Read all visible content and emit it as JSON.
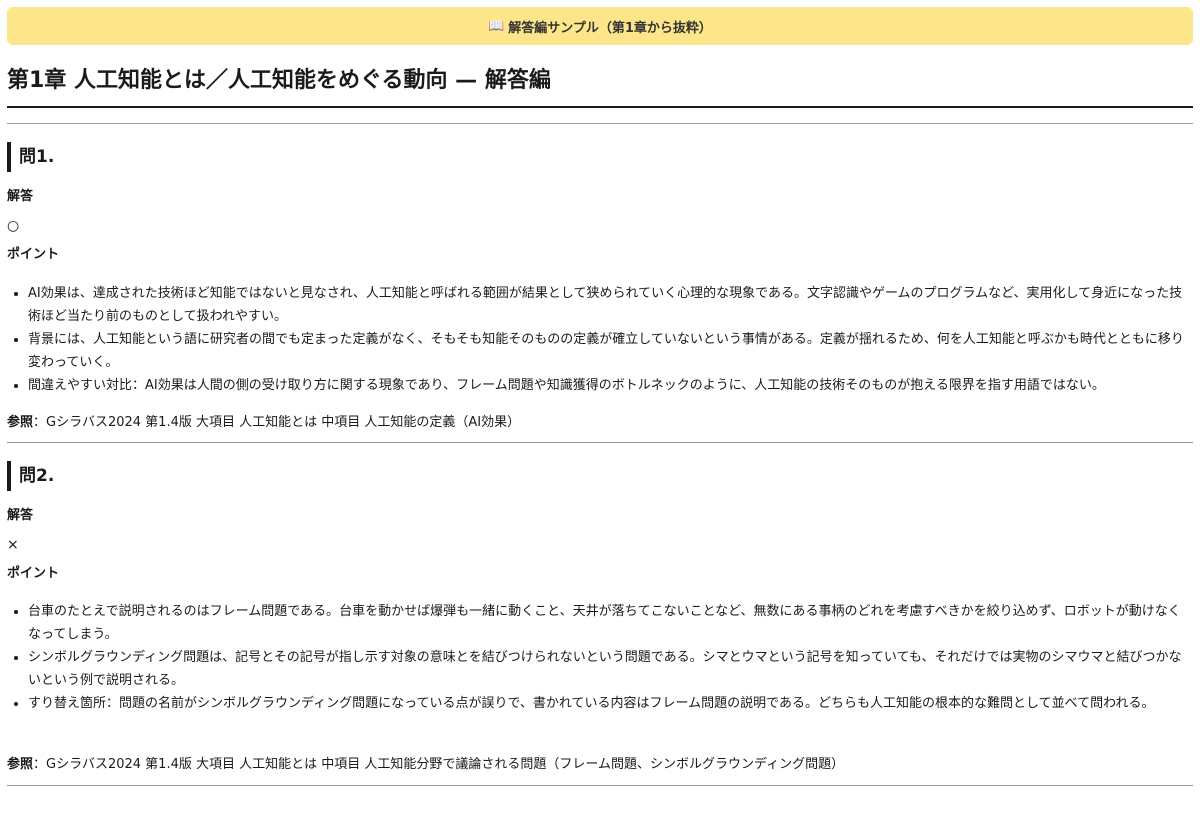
{
  "banner": {
    "icon": "open-book-icon",
    "text": "解答編サンプル（第1章から抜粋）"
  },
  "page_title": "第1章 人工知能とは／人工知能をめぐる動向 — 解答編",
  "labels": {
    "answer": "解答",
    "points": "ポイント",
    "reference": "参照"
  },
  "questions": [
    {
      "heading": "問1.",
      "answer": "○",
      "points": [
        "AI効果は、達成された技術ほど知能ではないと見なされ、人工知能と呼ばれる範囲が結果として狭められていく心理的な現象である。文字認識やゲームのプログラムなど、実用化して身近になった技術ほど当たり前のものとして扱われやすい。",
        "背景には、人工知能という語に研究者の間でも定まった定義がなく、そもそも知能そのものの定義が確立していないという事情がある。定義が揺れるため、何を人工知能と呼ぶかも時代とともに移り変わっていく。",
        "間違えやすい対比：AI効果は人間の側の受け取り方に関する現象であり、フレーム問題や知識獲得のボトルネックのように、人工知能の技術そのものが抱える限界を指す用語ではない。"
      ],
      "reference": "：Gシラバス2024 第1.4版 大項目 人工知能とは 中項目 人工知能の定義（AI効果）"
    },
    {
      "heading": "問2.",
      "answer": "×",
      "points": [
        "台車のたとえで説明されるのはフレーム問題である。台車を動かせば爆弾も一緒に動くこと、天井が落ちてこないことなど、無数にある事柄のどれを考慮すべきかを絞り込めず、ロボットが動けなくなってしまう。",
        "シンボルグラウンディング問題は、記号とその記号が指し示す対象の意味とを結びつけられないという問題である。シマとウマという記号を知っていても、それだけでは実物のシマウマと結びつかないという例で説明される。",
        "すり替え箇所：問題の名前がシンボルグラウンディング問題になっている点が誤りで、書かれている内容はフレーム問題の説明である。どちらも人工知能の根本的な難問として並べて問われる。"
      ],
      "reference": "：Gシラバス2024 第1.4版 大項目 人工知能とは 中項目 人工知能分野で議論される問題（フレーム問題、シンボルグラウンディング問題）"
    }
  ]
}
